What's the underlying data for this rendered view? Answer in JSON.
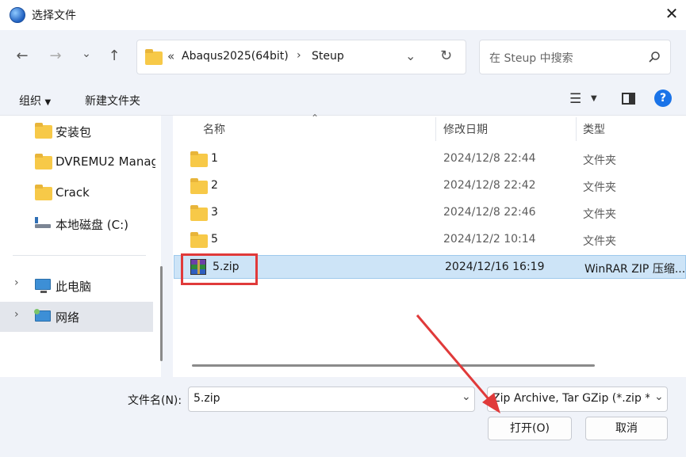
{
  "window": {
    "title": "选择文件",
    "close_icon": "close-icon"
  },
  "nav": {
    "back_icon": "back-arrow-icon",
    "forward_icon": "forward-arrow-icon",
    "recent_icon": "chevron-down-icon",
    "up_icon": "up-arrow-icon"
  },
  "address": {
    "overflow": "«",
    "crumbs": [
      "Abaqus2025(64bit)",
      "Steup"
    ],
    "separator": "›"
  },
  "search": {
    "placeholder": "在 Steup 中搜索"
  },
  "toolbar": {
    "organize": "组织",
    "new_folder": "新建文件夹"
  },
  "sidebar": {
    "items": [
      {
        "label": "安装包",
        "icon": "folder-icon"
      },
      {
        "label": "DVREMU2 Manag",
        "icon": "folder-icon"
      },
      {
        "label": "Crack",
        "icon": "folder-icon"
      },
      {
        "label": "本地磁盘 (C:)",
        "icon": "drive-icon"
      },
      {
        "label": "此电脑",
        "icon": "computer-icon"
      },
      {
        "label": "网络",
        "icon": "network-icon"
      }
    ]
  },
  "columns": {
    "name": "名称",
    "date": "修改日期",
    "type": "类型"
  },
  "files": [
    {
      "name": "1",
      "date": "2024/12/8 22:44",
      "type": "文件夹",
      "icon": "folder-icon"
    },
    {
      "name": "2",
      "date": "2024/12/8 22:42",
      "type": "文件夹",
      "icon": "folder-icon"
    },
    {
      "name": "3",
      "date": "2024/12/8 22:46",
      "type": "文件夹",
      "icon": "folder-icon"
    },
    {
      "name": "5",
      "date": "2024/12/2 10:14",
      "type": "文件夹",
      "icon": "folder-icon"
    },
    {
      "name": "5.zip",
      "date": "2024/12/16 16:19",
      "type": "WinRAR ZIP 压缩...",
      "icon": "winrar-icon",
      "selected": true
    }
  ],
  "footer": {
    "filename_label": "文件名(N):",
    "filename_value": "5.zip",
    "filter_value": "Zip Archive, Tar GZip (*.zip *.",
    "open_label": "打开(O)",
    "cancel_label": "取消"
  },
  "colors": {
    "accent": "#0067c0",
    "selection": "#cde4f7",
    "annotation": "#e03a3a"
  }
}
